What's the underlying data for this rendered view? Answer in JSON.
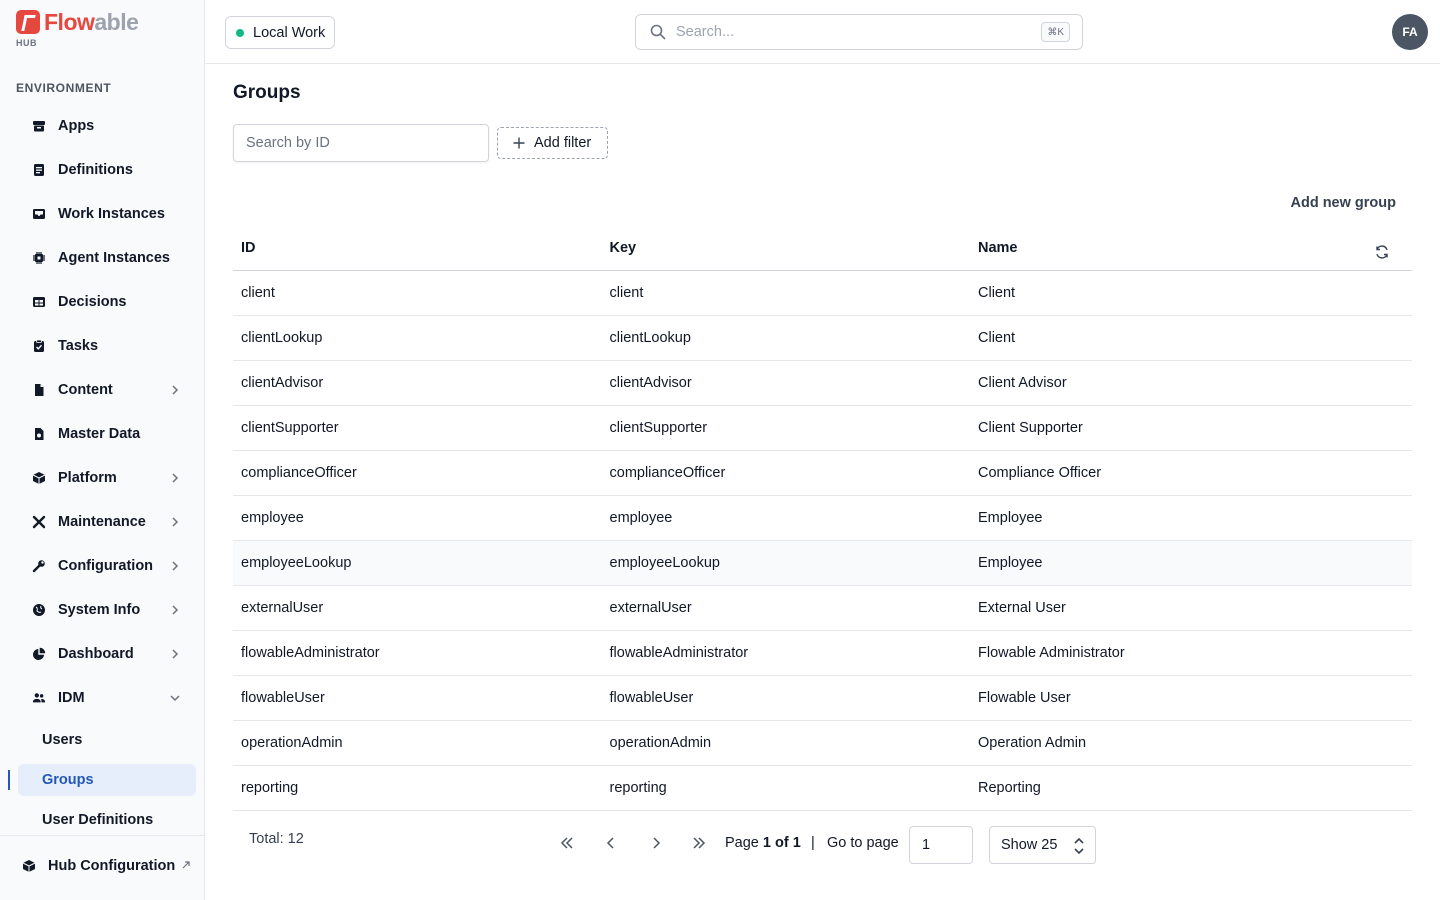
{
  "brand": {
    "logo_flow": "Flow",
    "logo_able": "able",
    "logo_sub": "HUB"
  },
  "sidebar": {
    "section_label": "ENVIRONMENT",
    "items": [
      {
        "label": "Apps",
        "icon": "box-icon"
      },
      {
        "label": "Definitions",
        "icon": "document-icon"
      },
      {
        "label": "Work Instances",
        "icon": "inbox-icon"
      },
      {
        "label": "Agent Instances",
        "icon": "cpu-chip-icon"
      },
      {
        "label": "Decisions",
        "icon": "table-icon"
      },
      {
        "label": "Tasks",
        "icon": "clipboard-check-icon"
      },
      {
        "label": "Content",
        "icon": "file-icon"
      },
      {
        "label": "Master Data",
        "icon": "database-document-icon"
      },
      {
        "label": "Platform",
        "icon": "cube-icon"
      },
      {
        "label": "Maintenance",
        "icon": "wrench-screwdriver-icon"
      },
      {
        "label": "Configuration",
        "icon": "wrench-icon"
      },
      {
        "label": "System Info",
        "icon": "globe-icon"
      },
      {
        "label": "Dashboard",
        "icon": "pie-chart-icon"
      },
      {
        "label": "IDM",
        "icon": "users-icon"
      }
    ],
    "idm_sub": [
      {
        "label": "Users"
      },
      {
        "label": "Groups"
      },
      {
        "label": "User Definitions"
      }
    ],
    "hub_config": "Hub Configuration"
  },
  "topbar": {
    "environment": "Local Work",
    "search_placeholder": "Search...",
    "search_shortcut": "⌘K",
    "avatar_initials": "FA"
  },
  "main": {
    "title": "Groups",
    "id_search_placeholder": "Search by ID",
    "add_filter_label": "Add filter",
    "add_group_label": "Add new group",
    "columns": {
      "id": "ID",
      "key": "Key",
      "name": "Name"
    },
    "rows": [
      {
        "id": "client",
        "key": "client",
        "name": "Client"
      },
      {
        "id": "clientLookup",
        "key": "clientLookup",
        "name": "Client"
      },
      {
        "id": "clientAdvisor",
        "key": "clientAdvisor",
        "name": "Client Advisor"
      },
      {
        "id": "clientSupporter",
        "key": "clientSupporter",
        "name": "Client Supporter"
      },
      {
        "id": "complianceOfficer",
        "key": "complianceOfficer",
        "name": "Compliance Officer"
      },
      {
        "id": "employee",
        "key": "employee",
        "name": "Employee"
      },
      {
        "id": "employeeLookup",
        "key": "employeeLookup",
        "name": "Employee"
      },
      {
        "id": "externalUser",
        "key": "externalUser",
        "name": "External User"
      },
      {
        "id": "flowableAdministrator",
        "key": "flowableAdministrator",
        "name": "Flowable Administrator"
      },
      {
        "id": "flowableUser",
        "key": "flowableUser",
        "name": "Flowable User"
      },
      {
        "id": "operationAdmin",
        "key": "operationAdmin",
        "name": "Operation Admin"
      },
      {
        "id": "reporting",
        "key": "reporting",
        "name": "Reporting"
      }
    ]
  },
  "pagination": {
    "total": "Total: 12",
    "page_prefix": "Page ",
    "page_current": "1 of 1",
    "separator": "|",
    "goto_label": "Go to page",
    "goto_value": "1",
    "show_label": "Show 25"
  },
  "colors": {
    "accent": "#2358b7",
    "brand": "#e5483f",
    "status_online": "#10b981"
  }
}
